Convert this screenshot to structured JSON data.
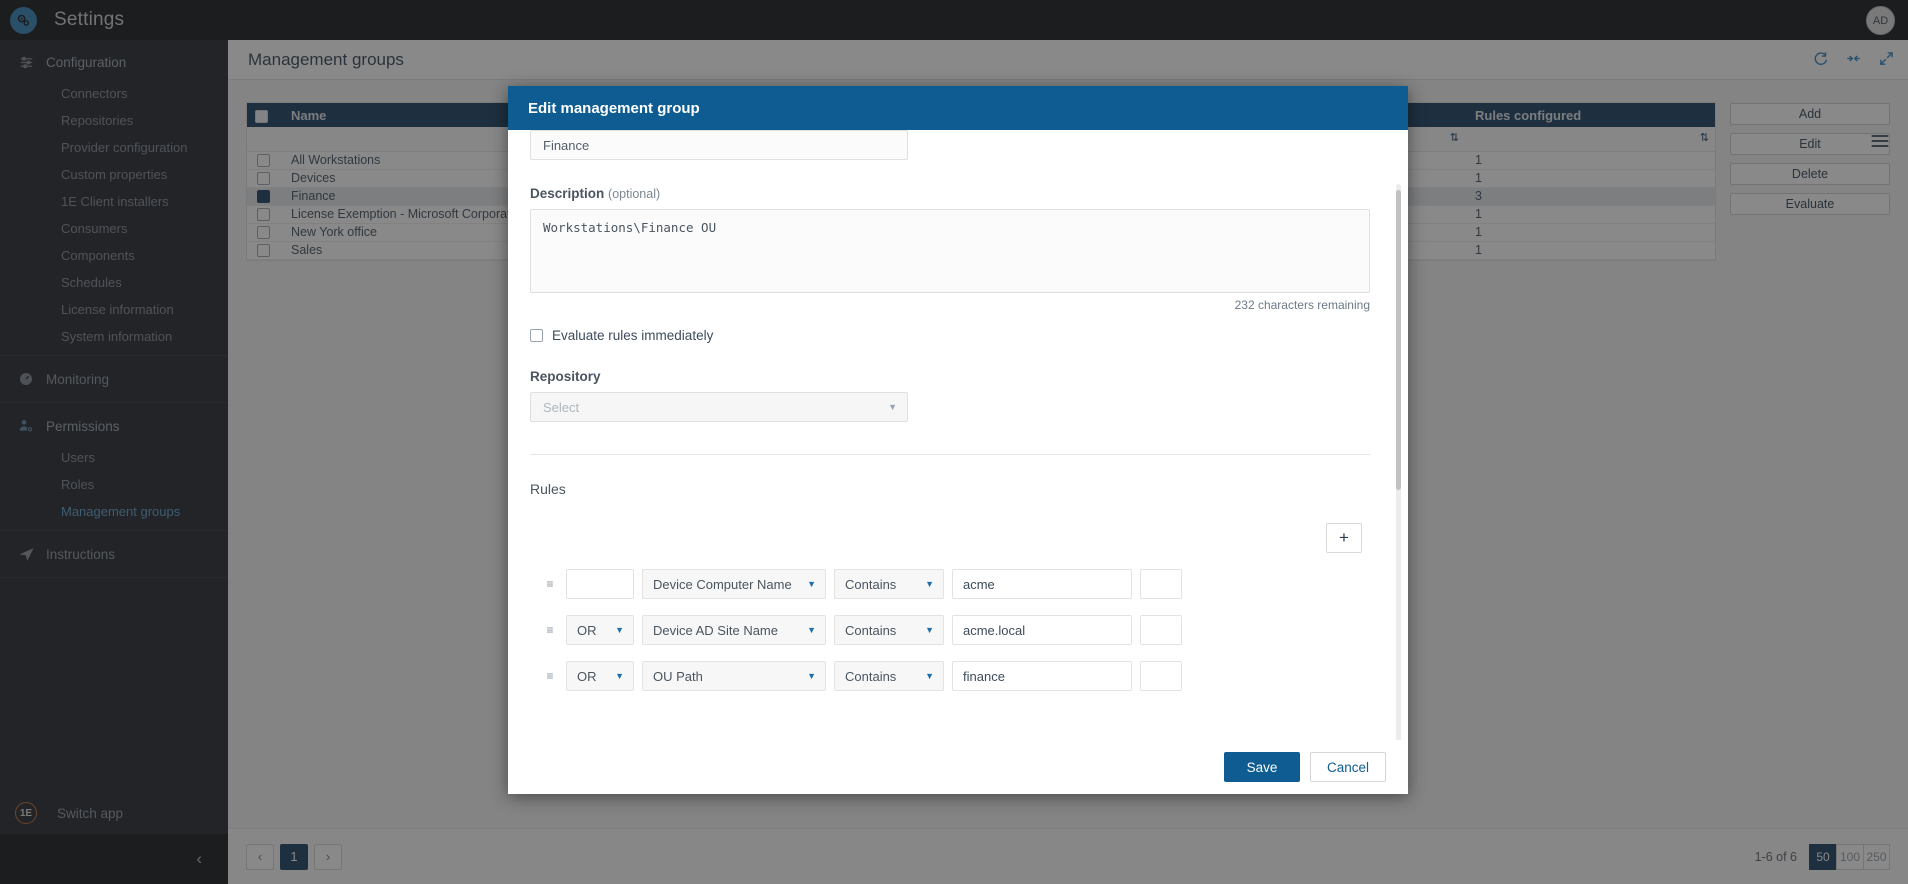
{
  "topbar": {
    "app_title": "Settings",
    "logo_icon": "gears-icon",
    "avatar_initials": "AD"
  },
  "sidebar": {
    "groups": [
      {
        "label": "Configuration",
        "icon": "sliders-icon",
        "active": true,
        "items": [
          {
            "label": "Connectors",
            "selected": false
          },
          {
            "label": "Repositories",
            "selected": false
          },
          {
            "label": "Provider configuration",
            "selected": false
          },
          {
            "label": "Custom properties",
            "selected": false
          },
          {
            "label": "1E Client installers",
            "selected": false
          },
          {
            "label": "Consumers",
            "selected": false
          },
          {
            "label": "Components",
            "selected": false
          },
          {
            "label": "Schedules",
            "selected": false
          },
          {
            "label": "License information",
            "selected": false
          },
          {
            "label": "System information",
            "selected": false
          }
        ]
      },
      {
        "label": "Monitoring",
        "icon": "gauge-icon",
        "active": false,
        "items": []
      },
      {
        "label": "Permissions",
        "icon": "user-gear-icon",
        "active": true,
        "items": [
          {
            "label": "Users",
            "selected": false
          },
          {
            "label": "Roles",
            "selected": false
          },
          {
            "label": "Management groups",
            "selected": true
          }
        ]
      },
      {
        "label": "Instructions",
        "icon": "paper-plane-icon",
        "active": false,
        "items": []
      }
    ],
    "switch_app_label": "Switch app",
    "switch_app_icon": "one-e-logo-icon",
    "collapse_icon": "chevron-left-icon"
  },
  "page": {
    "title": "Management groups",
    "header_icons": [
      "refresh-icon",
      "collapse-columns-icon",
      "expand-icon"
    ],
    "menu_icon": "hamburger-menu-icon"
  },
  "table": {
    "columns": [
      "Name",
      "Rules configured"
    ],
    "rows": [
      {
        "name": "All Workstations",
        "rules": "1",
        "checked": false,
        "selected": false
      },
      {
        "name": "Devices",
        "rules": "1",
        "checked": false,
        "selected": false
      },
      {
        "name": "Finance",
        "rules": "3",
        "checked": true,
        "selected": true
      },
      {
        "name": "License Exemption - Microsoft Corporation",
        "rules": "1",
        "checked": false,
        "selected": false
      },
      {
        "name": "New York office",
        "rules": "1",
        "checked": false,
        "selected": false
      },
      {
        "name": "Sales",
        "rules": "1",
        "checked": false,
        "selected": false
      }
    ],
    "sort_icon": "sort-updown-icon"
  },
  "actions": {
    "buttons": [
      "Add",
      "Edit",
      "Delete",
      "Evaluate"
    ]
  },
  "pagination": {
    "prev_icon": "chevron-left-icon",
    "next_icon": "chevron-right-icon",
    "current_page": "1",
    "range_label": "1-6 of 6",
    "page_sizes": [
      "50",
      "100",
      "250"
    ],
    "page_size_current": "50"
  },
  "modal": {
    "title": "Edit management group",
    "name_value": "Finance",
    "description_label": "Description",
    "description_optional": "(optional)",
    "description_value": "Workstations\\Finance OU",
    "chars_remaining": "232 characters remaining",
    "evaluate_label": "Evaluate rules immediately",
    "evaluate_checked": false,
    "repository_label": "Repository",
    "repository_placeholder": "Select",
    "repository_caret_icon": "chevron-down-icon",
    "rules_label": "Rules",
    "add_rule_icon": "plus-icon",
    "drag_icon": "drag-handle-icon",
    "rules": [
      {
        "conjunction": "",
        "property": "Device Computer Name",
        "operator": "Contains",
        "value": "acme"
      },
      {
        "conjunction": "OR",
        "property": "Device AD Site Name",
        "operator": "Contains",
        "value": "acme.local"
      },
      {
        "conjunction": "OR",
        "property": "OU Path",
        "operator": "Contains",
        "value": "finance"
      }
    ],
    "save_label": "Save",
    "cancel_label": "Cancel"
  },
  "colors": {
    "brand_blue": "#0e5c92",
    "header_navy": "#12395c",
    "sidebar_bg": "#1b2029",
    "accent_link": "#5b9bc9"
  }
}
